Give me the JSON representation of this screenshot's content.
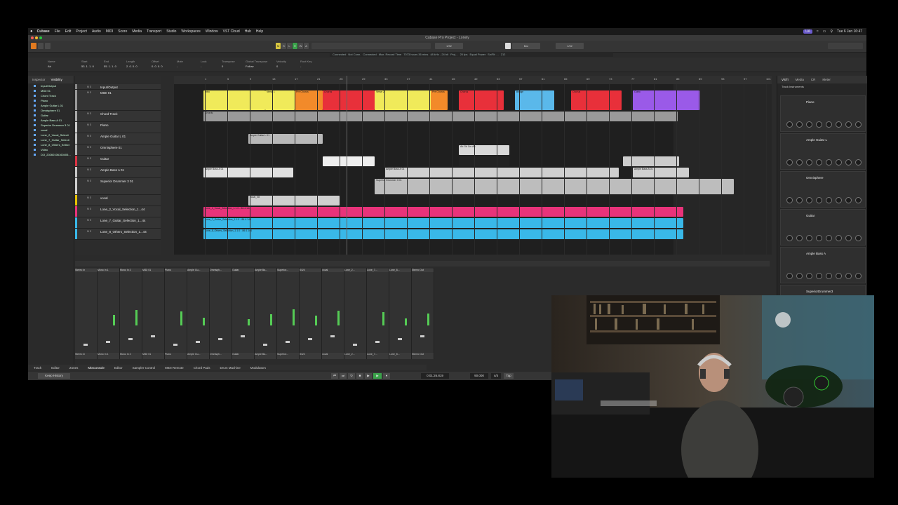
{
  "menubar": {
    "app": "Cubase",
    "items": [
      "File",
      "Edit",
      "Project",
      "Audio",
      "MIDI",
      "Score",
      "Media",
      "Transport",
      "Studio",
      "Workspaces",
      "Window",
      "VST Cloud",
      "Hub",
      "Help"
    ],
    "clock": "Tue 6 Jan  16:47",
    "ua": "UA"
  },
  "window": {
    "title": "Cubase Pro Project - Lonely"
  },
  "toolbar": {
    "mode_letters": [
      "M",
      "S",
      "L",
      "R",
      "W",
      "A"
    ],
    "quantize": "1/32",
    "grid": "Bar",
    "snap": "1/32"
  },
  "status": [
    "Connected",
    "Not Conn.",
    "Connected",
    "Max. Record Time",
    "7073 hours 36 mins",
    "48 kHz - 24 bit",
    "Proj...",
    "20 fps",
    "Equal Power",
    "Sn/Rt: ...",
    "212"
  ],
  "infoline": {
    "headers": [
      "Name",
      "Start",
      "End",
      "Length",
      "Offset",
      "Mute",
      "Lock",
      "Transpose",
      "Global Transpose",
      "Velocity",
      "Root Key"
    ],
    "values": [
      "Ab",
      "53. 1. 1. 0",
      "55. 1. 1. 0",
      "2. 0. 0. 0",
      "0. 0. 0. 0",
      "-",
      "-",
      "0",
      "Follow",
      "0",
      "-"
    ]
  },
  "inspector": {
    "tabs": [
      "Inspector",
      "Visibility"
    ],
    "items": [
      "Input/Output",
      "MIDI 01",
      "Chord Track",
      "Piano",
      "Ample Guitar L 01",
      "Omnisphere 01",
      "Guitar",
      "Ample Bass A 01",
      "Superior Drummer 3 01",
      "vocal",
      "Lone_2_Vocal_Selecti",
      "Lone_7_Guitar_Selecti",
      "Lone_8_Others_Select",
      "Video",
      "DJI_20260106160405..."
    ]
  },
  "tracks": [
    {
      "name": "Input/Output",
      "color": "#888888",
      "h": 8
    },
    {
      "name": "MIDI 01",
      "color": "#9a9a9a",
      "h": 30
    },
    {
      "name": "Chord Track",
      "color": "#aaaaaa",
      "h": 16
    },
    {
      "name": "Piano",
      "color": "#cccccc",
      "h": 16
    },
    {
      "name": "Ample Guitar L 01",
      "color": "#c0c0c0",
      "h": 16
    },
    {
      "name": "Omnisphere 01",
      "color": "#b0b0b0",
      "h": 16
    },
    {
      "name": "Guitar",
      "color": "#dd3344",
      "h": 16
    },
    {
      "name": "Ample Bass A 01",
      "color": "#c8c8c8",
      "h": 16
    },
    {
      "name": "Superior Drummer 3 01",
      "color": "#cfcfcf",
      "h": 24
    },
    {
      "name": "vocal",
      "color": "#e6c200",
      "h": 16
    },
    {
      "name": "Lone_2_Vocal_Selection_1...44",
      "color": "#e8337a",
      "h": 16
    },
    {
      "name": "Lone_7_Guitar_Selection_1...44",
      "color": "#39b8e8",
      "h": 16
    },
    {
      "name": "Lone_8_Others_Selection_1...44",
      "color": "#39b8e8",
      "h": 16
    }
  ],
  "arranger": {
    "sections": [
      {
        "label": "Intro",
        "color": "#f0ea5a"
      },
      {
        "label": "Verse 1",
        "color": "#f0ea5a"
      },
      {
        "label": "Pre Chorus",
        "color": "#f28a2a"
      },
      {
        "label": "Chorus",
        "color": "#e8303a"
      },
      {
        "label": "Verse 2",
        "color": "#f0ea5a"
      },
      {
        "label": "Pre Chorus",
        "color": "#f28a2a"
      },
      {
        "label": "Chorus",
        "color": "#e8303a"
      },
      {
        "label": "Bridge",
        "color": "#5ab8ea"
      },
      {
        "label": "Chorus",
        "color": "#e8303a"
      },
      {
        "label": "Outro",
        "color": "#9a5ae8"
      }
    ],
    "ruler": [
      "1",
      "5",
      "9",
      "13",
      "17",
      "21",
      "25",
      "29",
      "33",
      "37",
      "41",
      "45",
      "49",
      "53",
      "57",
      "61",
      "65",
      "69",
      "73",
      "77",
      "81",
      "85",
      "89",
      "93",
      "97",
      "101",
      "105"
    ],
    "clip_labels": {
      "chord": "Chords",
      "guitar_l": "Ample Guitar L 01",
      "omni": "Ab Gb Cm Ab",
      "bass": "Ample Bass A 01",
      "drums": "Superior Drummer 3 01",
      "vocal": "vocal_08",
      "lone2": "Lone_2_Vocal_Selection_1.1.0 - 86.4.144",
      "lone7": "Lone_7_Guitar_Selection_1.1.0 - 86.4.144",
      "lone8": "Lone_8_Others_Selection_1.1.0 - 86.4.144"
    }
  },
  "rightzone": {
    "tabs": [
      "VSTi",
      "Media",
      "CR",
      "Meter"
    ],
    "header": "Track Instruments",
    "instruments": [
      "Piano",
      "Ample Guitar L",
      "Omnisphere",
      "Guitar",
      "Ample Bass A",
      "SuperiorDrummer3"
    ]
  },
  "mixer": {
    "channels": [
      "Stereo In",
      "Mono In 1",
      "Mono In 2",
      "MIDI 01",
      "Piano",
      "Ample Gu...",
      "Omnisph...",
      "Guitar",
      "Ample Ba...",
      "Superior...",
      "SS/4",
      "vocal",
      "Lone_2...",
      "Lone_7...",
      "Lone_8...",
      "Stereo Out"
    ]
  },
  "lowerzone_tabs": [
    "Track",
    "Editor",
    "Zones",
    "MixConsole",
    "Editor",
    "Sampler Control",
    "MIDI Remote",
    "Chord Pads",
    "Drum Machine",
    "Modulators"
  ],
  "transport": {
    "history": "Keep History",
    "position": "0:01:26.819",
    "tempo": "90.000",
    "signature": "4/4",
    "tap": "Tap"
  }
}
